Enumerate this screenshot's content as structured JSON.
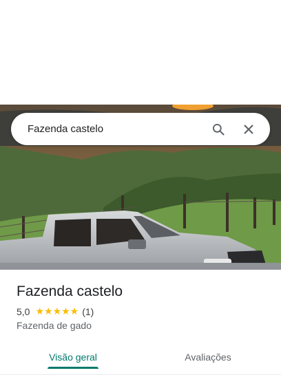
{
  "search": {
    "query": "Fazenda castelo"
  },
  "icons": {
    "search": "search-icon",
    "close": "close-icon"
  },
  "place": {
    "name": "Fazenda castelo",
    "rating": "5,0",
    "stars": "★★★★★",
    "review_count": "(1)",
    "category": "Fazenda de gado"
  },
  "tabs": [
    {
      "label": "Visão geral",
      "active": true
    },
    {
      "label": "Avaliações",
      "active": false
    }
  ],
  "colors": {
    "accent": "#00796b",
    "star": "#fbbc04"
  }
}
